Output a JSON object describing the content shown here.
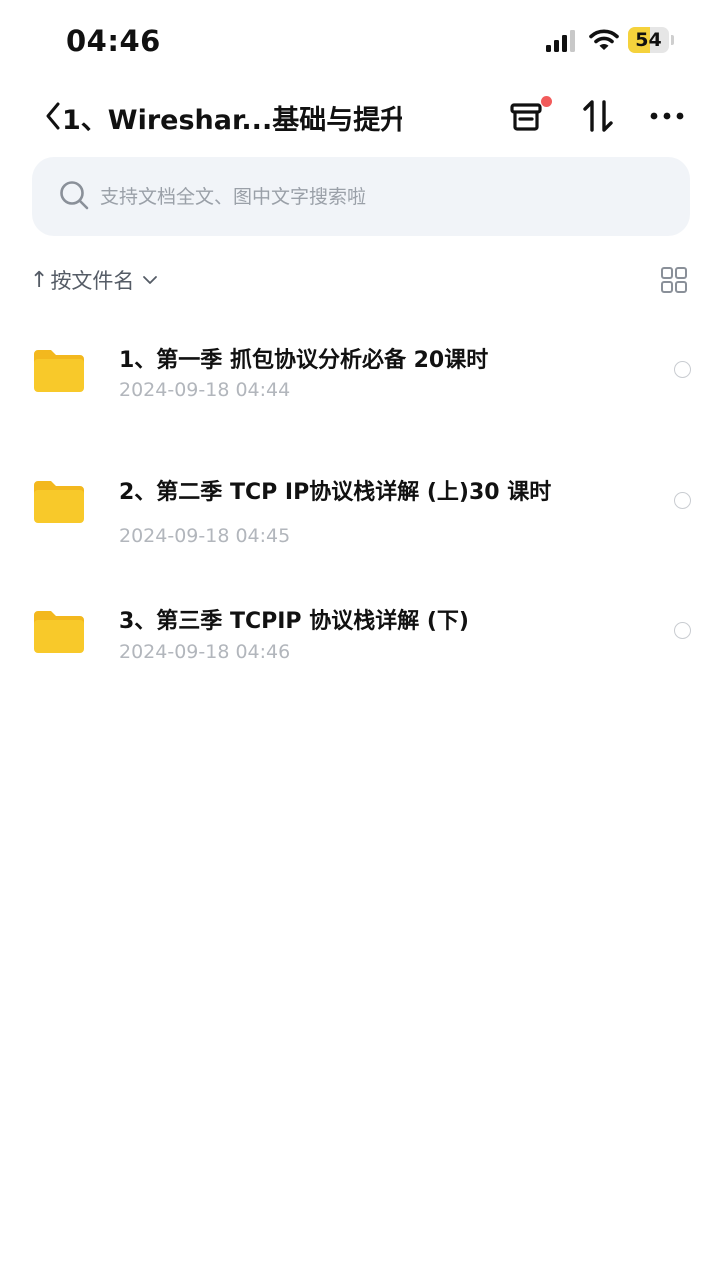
{
  "status_bar": {
    "time": "04:46",
    "battery_level": "54",
    "battery_fraction": 0.54,
    "icons": [
      "cellular-signal-icon",
      "wifi-icon",
      "battery-icon"
    ]
  },
  "nav": {
    "back_icon": "chevron-left-icon",
    "title": "1、Wireshar...基础与提升",
    "actions": [
      "transfer-list-icon",
      "sort-icon",
      "more-icon"
    ],
    "notification_dot_color": "#f25b5b"
  },
  "search": {
    "placeholder": "支持文档全文、图中文字搜索啦",
    "value": ""
  },
  "sort": {
    "arrow": "↑",
    "label": "按文件名",
    "view_toggle_icon": "grid-view-icon"
  },
  "files": [
    {
      "name": "1、第一季 抓包协议分析必备 20课时",
      "date": "2024-09-18 04:44",
      "type": "folder"
    },
    {
      "name": "2、第二季 TCP IP协议栈详解 (上)30 课时",
      "date": "2024-09-18 04:45",
      "type": "folder"
    },
    {
      "name": "3、第三季 TCPIP 协议栈详解 (下)",
      "date": "2024-09-18 04:46",
      "type": "folder"
    }
  ],
  "colors": {
    "folder": "#f8c92a",
    "folder_tab": "#f3b81e",
    "search_background": "#f1f4f8",
    "secondary_text": "#b2b6bc",
    "battery_fill": "#f5d23c"
  }
}
